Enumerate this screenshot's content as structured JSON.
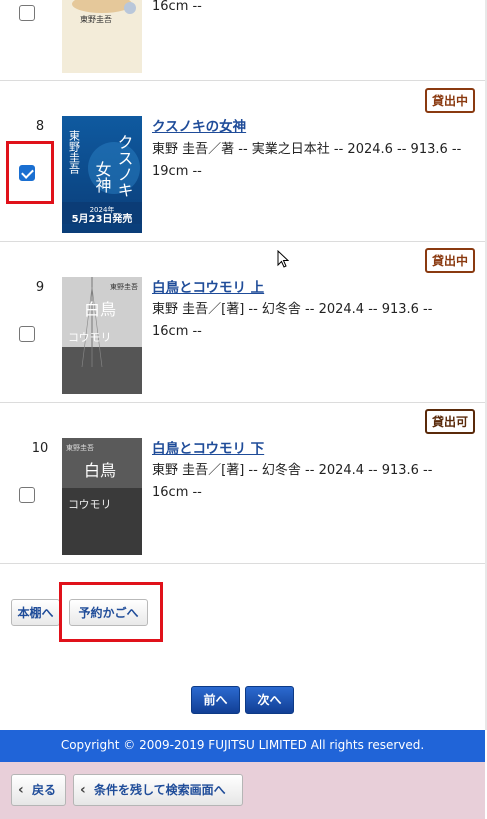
{
  "items": [
    {
      "meta": "16cm --",
      "cover_author": "東野圭吾",
      "checked": false
    },
    {
      "number": "8",
      "badge": "貸出中",
      "title": "クスノキの女神",
      "meta": "東野 圭吾／著 -- 実業之日本社 -- 2024.6 -- 913.6 -- 19cm --",
      "cover_title": "クスノキの女神",
      "cover_author": "東野圭吾",
      "cover_note": "2024年 5月23日発売",
      "checked": true
    },
    {
      "number": "9",
      "badge": "貸出中",
      "title": "白鳥とコウモリ 上",
      "meta": "東野 圭吾／[著] -- 幻冬舎 -- 2024.4 -- 913.6 -- 16cm --",
      "cover_author": "東野圭吾",
      "cover_title": "白鳥とコウモリ",
      "checked": false
    },
    {
      "number": "10",
      "badge": "貸出可",
      "title": "白鳥とコウモリ 下",
      "meta": "東野 圭吾／[著] -- 幻冬舎 -- 2024.4 -- 913.6 -- 16cm --",
      "cover_author": "東野圭吾",
      "cover_title": "白鳥とコウモリ",
      "checked": false
    }
  ],
  "actions": {
    "bookshelf_label": "本棚へ",
    "reserve_cart_label": "予約かごへ"
  },
  "pagination": {
    "prev_label": "前へ",
    "next_label": "次へ"
  },
  "footer": {
    "copyright": "Copyright © 2009-2019 FUJITSU LIMITED All rights reserved."
  },
  "bottom_nav": {
    "back_label": "戻る",
    "back_to_search_label": "条件を残して検索画面へ"
  },
  "colors": {
    "primary": "#2064d8",
    "highlight": "#e0111a",
    "badge_border": "#8a3a10",
    "bottom_bar": "#e8cfd9"
  }
}
